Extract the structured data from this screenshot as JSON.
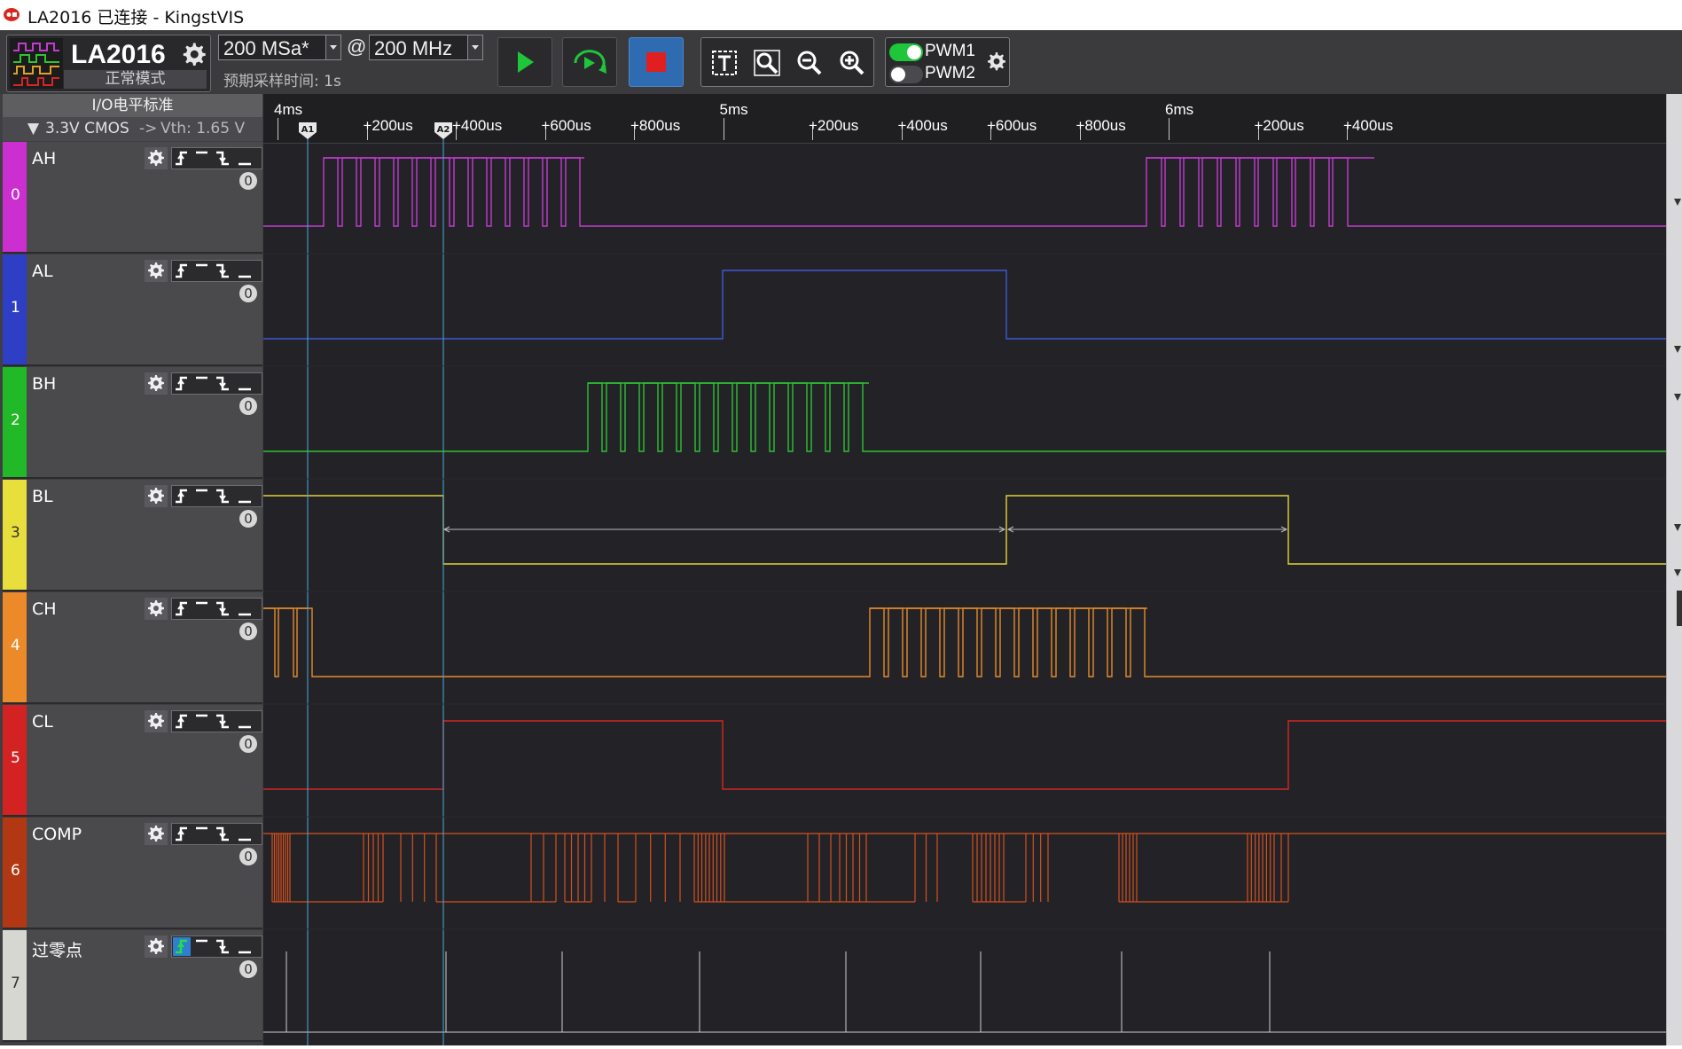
{
  "window": {
    "title": "LA2016 已连接 - KingstVIS"
  },
  "device": {
    "name": "LA2016",
    "mode": "正常模式"
  },
  "sampling": {
    "rate": "200 MSa*",
    "at": "@",
    "frequency": "200 MHz",
    "expected_time": "预期采样时间: 1s"
  },
  "pwm": {
    "pwm1_label": "PWM1",
    "pwm1_on": true,
    "pwm2_label": "PWM2",
    "pwm2_on": false
  },
  "io": {
    "header": "I/O电平标准",
    "standard": "3.3V CMOS",
    "arrow": "->",
    "vth": "Vth: 1.65 V"
  },
  "ruler": {
    "labels": [
      {
        "text": "4ms",
        "kind": "major"
      },
      {
        "text": "+200us",
        "kind": "minor"
      },
      {
        "text": "+400us",
        "kind": "minor"
      },
      {
        "text": "+600us",
        "kind": "minor"
      },
      {
        "text": "+800us",
        "kind": "minor"
      },
      {
        "text": "5ms",
        "kind": "major"
      },
      {
        "text": "+200us",
        "kind": "minor"
      },
      {
        "text": "+400us",
        "kind": "minor"
      },
      {
        "text": "+600us",
        "kind": "minor"
      },
      {
        "text": "+800us",
        "kind": "minor"
      },
      {
        "text": "6ms",
        "kind": "major"
      },
      {
        "text": "+200us",
        "kind": "minor"
      },
      {
        "text": "+400us",
        "kind": "minor"
      }
    ],
    "cursors": [
      {
        "label": "A1"
      },
      {
        "label": "A2"
      }
    ]
  },
  "channels": [
    {
      "index": "0",
      "name": "AH",
      "count": "0",
      "color": "#c23ccf",
      "stripe": "#cc2fd0"
    },
    {
      "index": "1",
      "name": "AL",
      "count": "0",
      "color": "#3f57d6",
      "stripe": "#2e3fc6"
    },
    {
      "index": "2",
      "name": "BH",
      "count": "0",
      "color": "#2ec233",
      "stripe": "#22b928"
    },
    {
      "index": "3",
      "name": "BL",
      "count": "0",
      "color": "#e1d23a",
      "stripe": "#e8de3c"
    },
    {
      "index": "4",
      "name": "CH",
      "count": "0",
      "color": "#e38b2d",
      "stripe": "#ec8a2a"
    },
    {
      "index": "5",
      "name": "CL",
      "count": "0",
      "color": "#d52525",
      "stripe": "#d22222"
    },
    {
      "index": "6",
      "name": "COMP",
      "count": "0",
      "color": "#d4501f",
      "stripe": "#b23814"
    },
    {
      "index": "7",
      "name": "过零点",
      "count": "0",
      "color": "#cfcfcf",
      "stripe": "#d7d7d2"
    }
  ],
  "icons": {
    "app_logo": "app-logo-icon",
    "device": "logic-analyzer-icon",
    "settings": "gear-icon",
    "run": "play-icon",
    "repeat": "repeat-run-icon",
    "stop": "stop-icon",
    "text_search": "text-search-icon",
    "search": "magnifier-icon",
    "zoom_out": "zoom-out-icon",
    "zoom_in": "zoom-in-icon",
    "edge_rising": "rising-edge-icon",
    "level_high": "high-level-icon",
    "edge_falling": "falling-edge-icon",
    "level_low": "low-level-icon"
  }
}
